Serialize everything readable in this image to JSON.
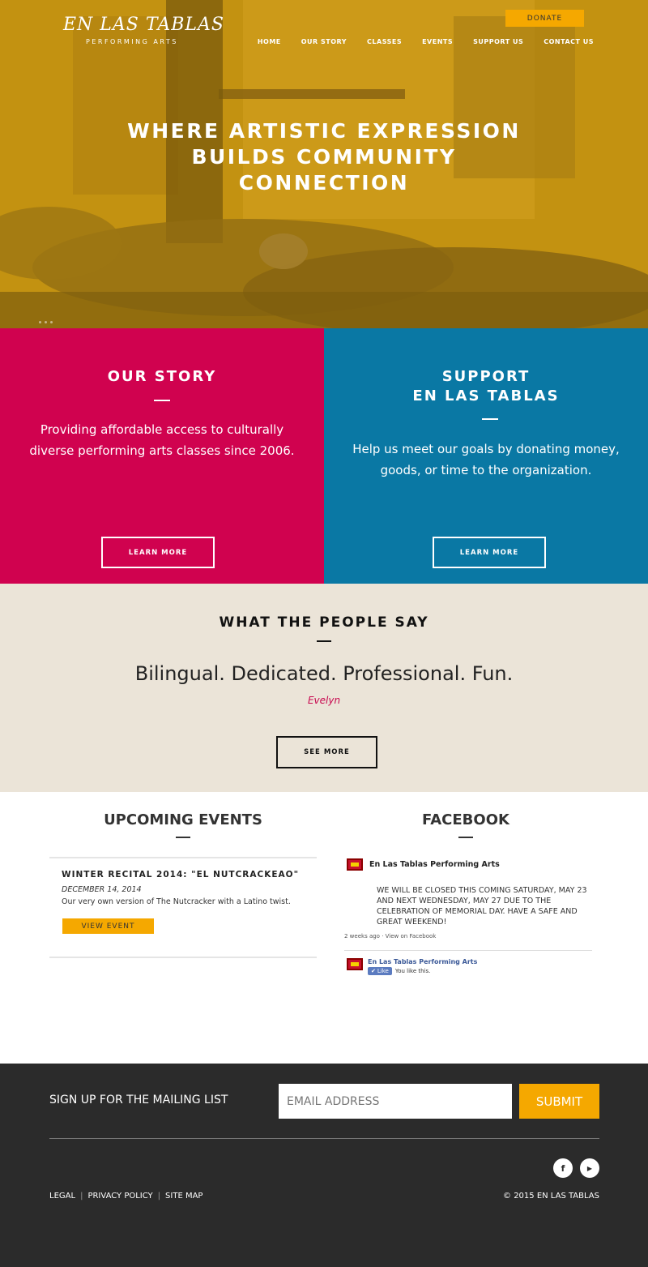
{
  "header": {
    "logo_main": "EN LAS TABLAS",
    "logo_sub": "PERFORMING ARTS",
    "donate_label": "DONATE",
    "nav": [
      "HOME",
      "OUR STORY",
      "CLASSES",
      "EVENTS",
      "SUPPORT US",
      "CONTACT US"
    ]
  },
  "hero": {
    "title_line1": "WHERE ARTISTIC EXPRESSION",
    "title_line2": "BUILDS COMMUNITY",
    "title_line3": "CONNECTION"
  },
  "story": {
    "title": "OUR STORY",
    "text_line1": "Providing affordable access to culturally",
    "text_line2": "diverse performing arts classes since 2006.",
    "button": "LEARN MORE"
  },
  "support": {
    "title_line1": "SUPPORT",
    "title_line2": "EN LAS TABLAS",
    "text_line1": "Help us meet our goals by donating money,",
    "text_line2": "goods, or time to the organization.",
    "button": "LEARN MORE"
  },
  "testimonial": {
    "title": "WHAT THE PEOPLE SAY",
    "quote": "Bilingual. Dedicated. Professional. Fun.",
    "author": "Evelyn",
    "button": "SEE MORE"
  },
  "events": {
    "title": "UPCOMING EVENTS",
    "items": [
      {
        "name": "WINTER RECITAL 2014: \"EL NUTCRACKEAO\"",
        "date": "DECEMBER 14, 2014",
        "description": "Our very own version of The Nutcracker with a Latino twist.",
        "button": "VIEW EVENT"
      }
    ]
  },
  "facebook": {
    "title": "FACEBOOK",
    "page_name": "En Las Tablas Performing Arts",
    "post_text": "WE WILL BE CLOSED THIS COMING SATURDAY, MAY 23 AND NEXT WEDNESDAY, MAY 27 DUE TO THE CELEBRATION OF MEMORIAL DAY. HAVE A SAFE AND GREAT WEEKEND!",
    "post_age": "2 weeks ago",
    "meta_sep": "·",
    "view_link": "View on Facebook",
    "like_page_name": "En Las Tablas Performing Arts",
    "like_button": "Like",
    "like_status": "You like this."
  },
  "footer": {
    "mailing_label": "SIGN UP FOR THE MAILING LIST",
    "email_placeholder": "EMAIL ADDRESS",
    "submit_label": "SUBMIT",
    "social": [
      "f",
      "▶"
    ],
    "links": [
      "LEGAL",
      "PRIVACY POLICY",
      "SITE MAP"
    ],
    "link_sep": "|",
    "copyright": "© 2015 EN LAS TABLAS"
  },
  "colors": {
    "accent": "#f5a800",
    "story_bg": "#d0024f",
    "support_bg": "#0a78a4",
    "testimonial_bg": "#ebe4d8",
    "footer_bg": "#2b2b2b"
  }
}
